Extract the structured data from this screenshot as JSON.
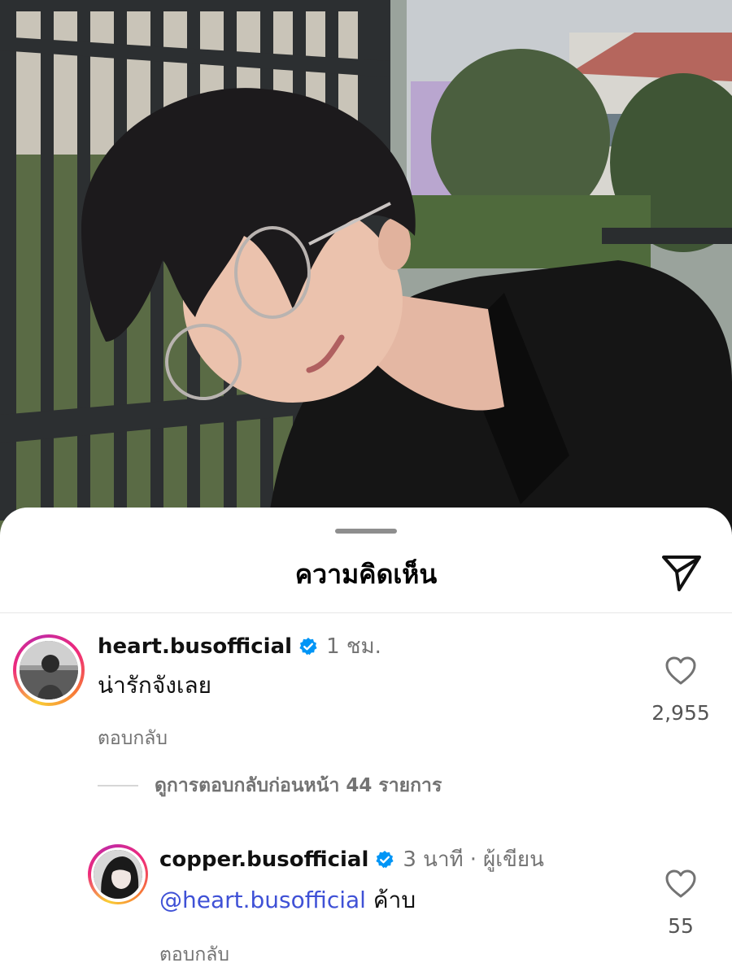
{
  "photo": {
    "description_icon": "post-photo"
  },
  "sheet": {
    "title": "ความคิดเห็น",
    "send_icon": "send-icon"
  },
  "comments": [
    {
      "username": "heart.busofficial",
      "verified": true,
      "time": "1 ชม.",
      "text": "น่ารักจังเลย",
      "reply_label": "ตอบกลับ",
      "likes": "2,955"
    }
  ],
  "view_replies": {
    "label": "ดูการตอบกลับก่อนหน้า 44 รายการ"
  },
  "reply": {
    "username": "copper.busofficial",
    "verified": true,
    "time": "3 นาที",
    "separator": "·",
    "author_label": "ผู้เขียน",
    "mention": "@heart.busofficial",
    "text": "ค้าบ",
    "reply_label": "ตอบกลับ",
    "likes": "55"
  },
  "colors": {
    "verified_blue": "#0095f6",
    "mention_blue": "#3f51d6",
    "secondary_text": "#737373"
  }
}
